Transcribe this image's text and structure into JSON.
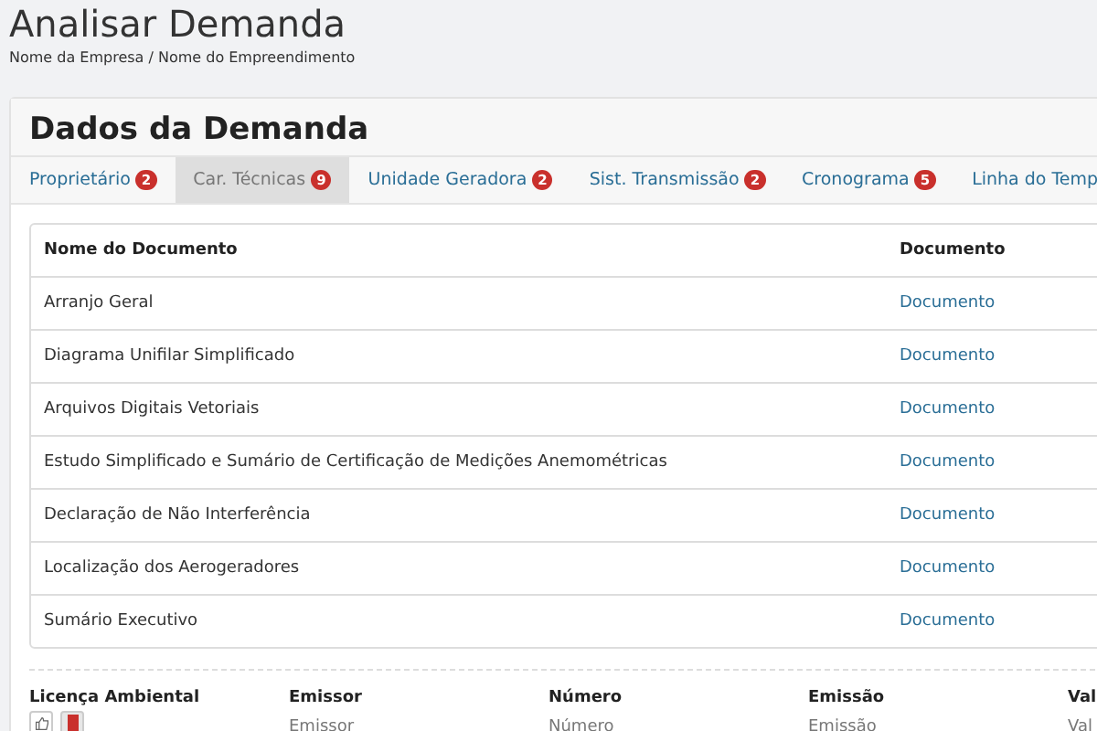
{
  "page": {
    "title": "Analisar Demanda",
    "breadcrumb": "Nome da Empresa / Nome do Empreendimento"
  },
  "panel": {
    "title": "Dados da Demanda",
    "tabs": [
      {
        "label": "Proprietário",
        "badge": "2",
        "selected": false
      },
      {
        "label": "Car. Técnicas",
        "badge": "9",
        "selected": true
      },
      {
        "label": "Unidade Geradora",
        "badge": "2",
        "selected": false
      },
      {
        "label": "Sist. Transmissão",
        "badge": "2",
        "selected": false
      },
      {
        "label": "Cronograma",
        "badge": "5",
        "selected": false
      },
      {
        "label": "Linha do Temp",
        "selected": false
      }
    ],
    "table": {
      "columns": [
        "Nome do Documento",
        "Documento"
      ],
      "rows": [
        [
          "Arranjo Geral",
          "Documento"
        ],
        [
          "Diagrama Unifilar Simplificado",
          "Documento"
        ],
        [
          "Arquivos Digitais Vetoriais",
          "Documento"
        ],
        [
          "Estudo Simplificado e Sumário de Certificação de Medições Anemométricas",
          "Documento"
        ],
        [
          "Declaração de Não Interferência",
          "Documento"
        ],
        [
          "Localização dos Aerogeradores",
          "Documento"
        ],
        [
          "Sumário Executivo",
          "Documento"
        ]
      ]
    },
    "license": {
      "columns": [
        "Licença Ambiental",
        "Emissor",
        "Número",
        "Emissão",
        "Val"
      ],
      "fields": [
        {
          "placeholder": "Emissor"
        },
        {
          "placeholder": "Número"
        },
        {
          "placeholder": "Emissão"
        },
        {
          "placeholder": "Val"
        }
      ]
    }
  }
}
